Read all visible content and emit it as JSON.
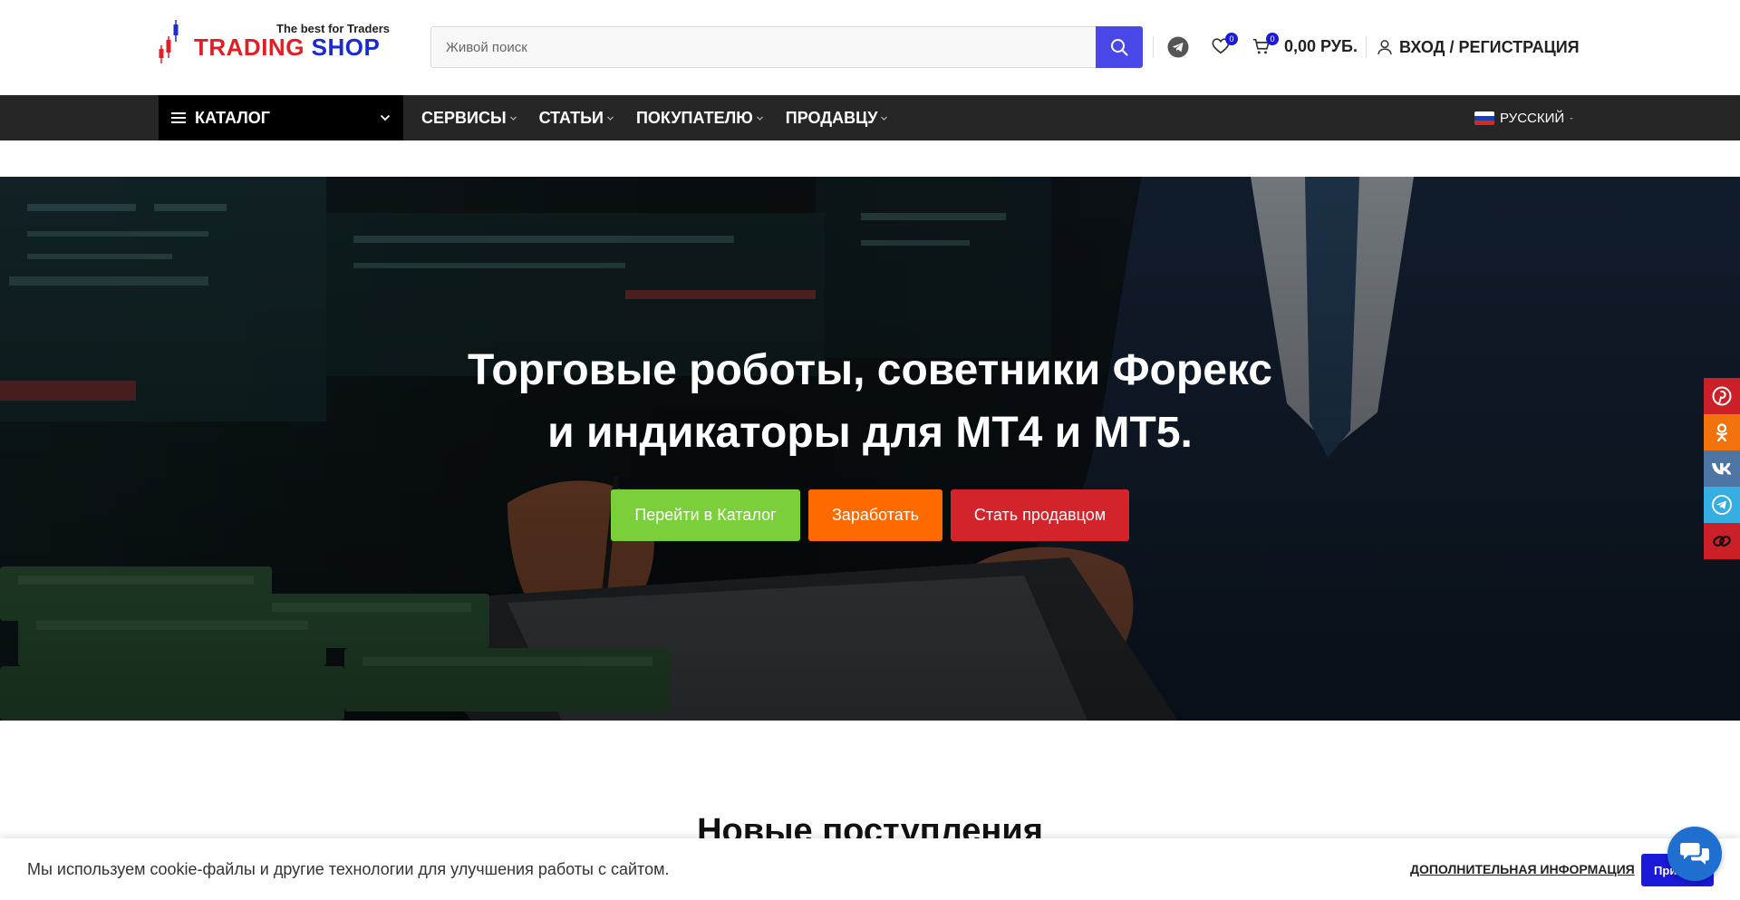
{
  "header": {
    "logo": {
      "tagline": "The best for Traders",
      "name_part1": "TRADING",
      "name_part2": "SHOP"
    },
    "search": {
      "placeholder": "Живой поиск"
    },
    "wishlist_count": "0",
    "cart_count": "0",
    "cart_total": "0,00 РУБ.",
    "login_label": "ВХОД / РЕГИСТРАЦИЯ"
  },
  "nav": {
    "catalog_label": "КАТАЛОГ",
    "items": [
      {
        "label": "СЕРВИСЫ"
      },
      {
        "label": "СТАТЬИ"
      },
      {
        "label": "ПОКУПАТЕЛЮ"
      },
      {
        "label": "ПРОДАВЦУ"
      }
    ],
    "language": "РУССКИЙ"
  },
  "hero": {
    "title_line1": "Торговые роботы, советники Форекс",
    "title_line2": "и индикаторы для MT4 и MT5.",
    "buttons": [
      {
        "label": "Перейти в Каталог",
        "color": "#7bcf3a"
      },
      {
        "label": "Заработать",
        "color": "#ff6a00"
      },
      {
        "label": "Стать продавцом",
        "color": "#d4242b"
      }
    ]
  },
  "social": [
    {
      "icon": "pinterest-icon",
      "color": "#cb2027"
    },
    {
      "icon": "odnoklassniki-icon",
      "color": "#f2720c"
    },
    {
      "icon": "vk-icon",
      "color": "#4c75a3"
    },
    {
      "icon": "telegram-icon",
      "color": "#37aee2"
    },
    {
      "icon": "link-icon",
      "color": "#cb2027"
    }
  ],
  "section": {
    "title": "Новые поступления"
  },
  "cookie": {
    "text": "Мы используем cookie-файлы и другие технологии для улучшения работы с сайтом.",
    "more_label": "ДОПОЛНИТЕЛЬНАЯ ИНФОРМАЦИЯ",
    "accept_label": "При"
  },
  "colors": {
    "accent": "#4a47e8",
    "nav_bg": "#262626",
    "badge": "#1a1ad8"
  }
}
